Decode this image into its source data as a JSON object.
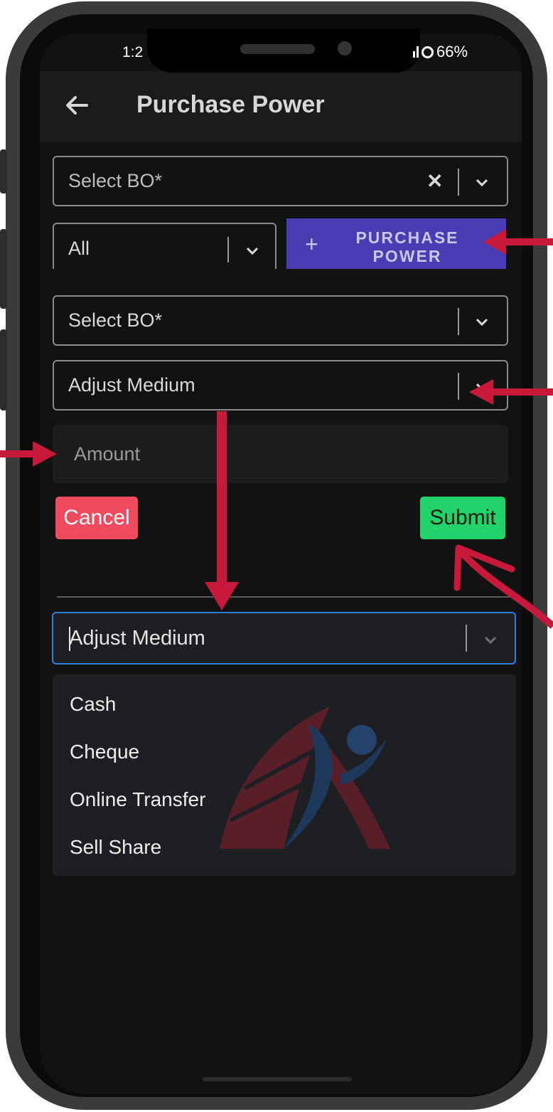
{
  "status_bar": {
    "time": "1:2",
    "battery": "66%"
  },
  "app_bar": {
    "title": "Purchase Power"
  },
  "filters": {
    "select_bo_placeholder": "Select BO*",
    "type_value": "All",
    "purchase_power_button": {
      "label_line1": "PURCHASE",
      "label_line2": "POWER",
      "icon": "plus-icon"
    }
  },
  "form": {
    "select_bo_placeholder": "Select BO*",
    "adjust_medium_placeholder": "Adjust Medium",
    "amount_placeholder": "Amount",
    "cancel_label": "Cancel",
    "submit_label": "Submit"
  },
  "adjust_medium_dropdown": {
    "value": "Adjust Medium",
    "options": [
      "Cash",
      "Cheque",
      "Online Transfer",
      "Sell Share"
    ]
  },
  "colors": {
    "purchase_power_button": "#4a3db3",
    "cancel": "#ef4a5e",
    "submit": "#22d36b",
    "focus_border": "#2f7dde",
    "annotation_arrow": "#c8193a"
  }
}
